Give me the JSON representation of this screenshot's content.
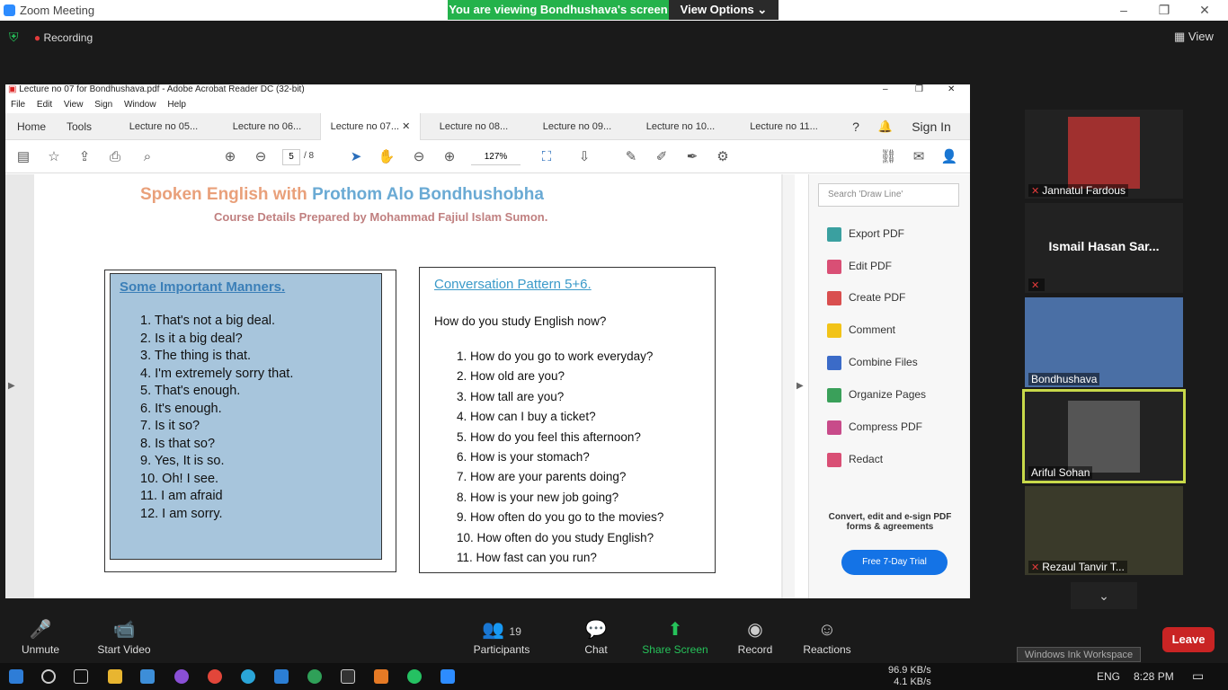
{
  "zoom": {
    "window_title": "Zoom Meeting",
    "viewing_banner": "You are viewing Bondhushava's screen",
    "view_options": "View Options",
    "recording": "Recording",
    "view": "View",
    "controls": [
      {
        "label": "Unmute",
        "icon": "mic-off-icon"
      },
      {
        "label": "Start Video",
        "icon": "video-off-icon"
      },
      {
        "label": "Participants",
        "icon": "participants-icon",
        "count": "19"
      },
      {
        "label": "Chat",
        "icon": "chat-icon"
      },
      {
        "label": "Share Screen",
        "icon": "share-screen-icon"
      },
      {
        "label": "Record",
        "icon": "record-icon"
      },
      {
        "label": "Reactions",
        "icon": "reactions-icon"
      }
    ],
    "leave": "Leave",
    "ink_tooltip": "Windows Ink Workspace",
    "participants": [
      {
        "name": "Jannatul Fardous",
        "muted": true
      },
      {
        "name": "Ismail Hasan Sar...",
        "muted": true
      },
      {
        "name": "Bondhushava",
        "muted": false
      },
      {
        "name": "Ariful Sohan",
        "muted": false
      },
      {
        "name": "Rezaul Tanvir T...",
        "muted": true
      }
    ]
  },
  "acrobat": {
    "title": "Lecture no 07 for Bondhushava.pdf - Adobe Acrobat Reader DC (32-bit)",
    "menu": [
      "File",
      "Edit",
      "View",
      "Sign",
      "Window",
      "Help"
    ],
    "tabs": [
      "Home",
      "Tools",
      "Lecture no 05...",
      "Lecture no 06...",
      "Lecture no 07...",
      "Lecture no 08...",
      "Lecture no 09...",
      "Lecture no 10...",
      "Lecture no 11..."
    ],
    "sign_in": "Sign In",
    "page_current": "5",
    "page_total": "/ 8",
    "zoom": "127%",
    "search_placeholder": "Search 'Draw Line'",
    "right_tools": [
      "Export PDF",
      "Edit PDF",
      "Create PDF",
      "Comment",
      "Combine Files",
      "Organize Pages",
      "Compress PDF",
      "Redact"
    ],
    "promo": "Convert, edit and e-sign PDF forms & agreements",
    "trial": "Free 7-Day Trial"
  },
  "doc": {
    "header_a": "Spoken English with ",
    "header_b": "Prothom Alo Bondhushobha",
    "course_line": "Course Details Prepared by Mohammad Fajiul Islam Sumon.",
    "manners_title": "Some Important Manners.",
    "manners": [
      "1.   That's not a big deal.",
      "2.   Is it a big deal?",
      "3.   The thing is that.",
      "4.   I'm extremely sorry that.",
      "5.   That's enough.",
      "6.   It's enough.",
      "7.   Is it so?",
      "8.   Is that so?",
      "9.   Yes, It is so.",
      "10. Oh! I see.",
      "11. I am afraid",
      "12. I am sorry."
    ],
    "conv_title": "Conversation Pattern 5+6.",
    "conv_sub": "How do you study English now?",
    "conv": [
      "1.    How do you go to work everyday?",
      "2.    How old are you?",
      "3.    How tall are you?",
      "4.    How can I buy a ticket?",
      "5.    How do you feel this afternoon?",
      "6.    How is your stomach?",
      "7.    How are your parents doing?",
      "8.    How is your new job going?",
      "9.    How often do you go to the movies?",
      "10.  How often do you study English?",
      "11.  How fast can you run?"
    ]
  },
  "taskbar": {
    "net_down": "96.9 KB/s",
    "net_up": "4.1 KB/s",
    "lang": "ENG",
    "time": "8:28 PM"
  }
}
